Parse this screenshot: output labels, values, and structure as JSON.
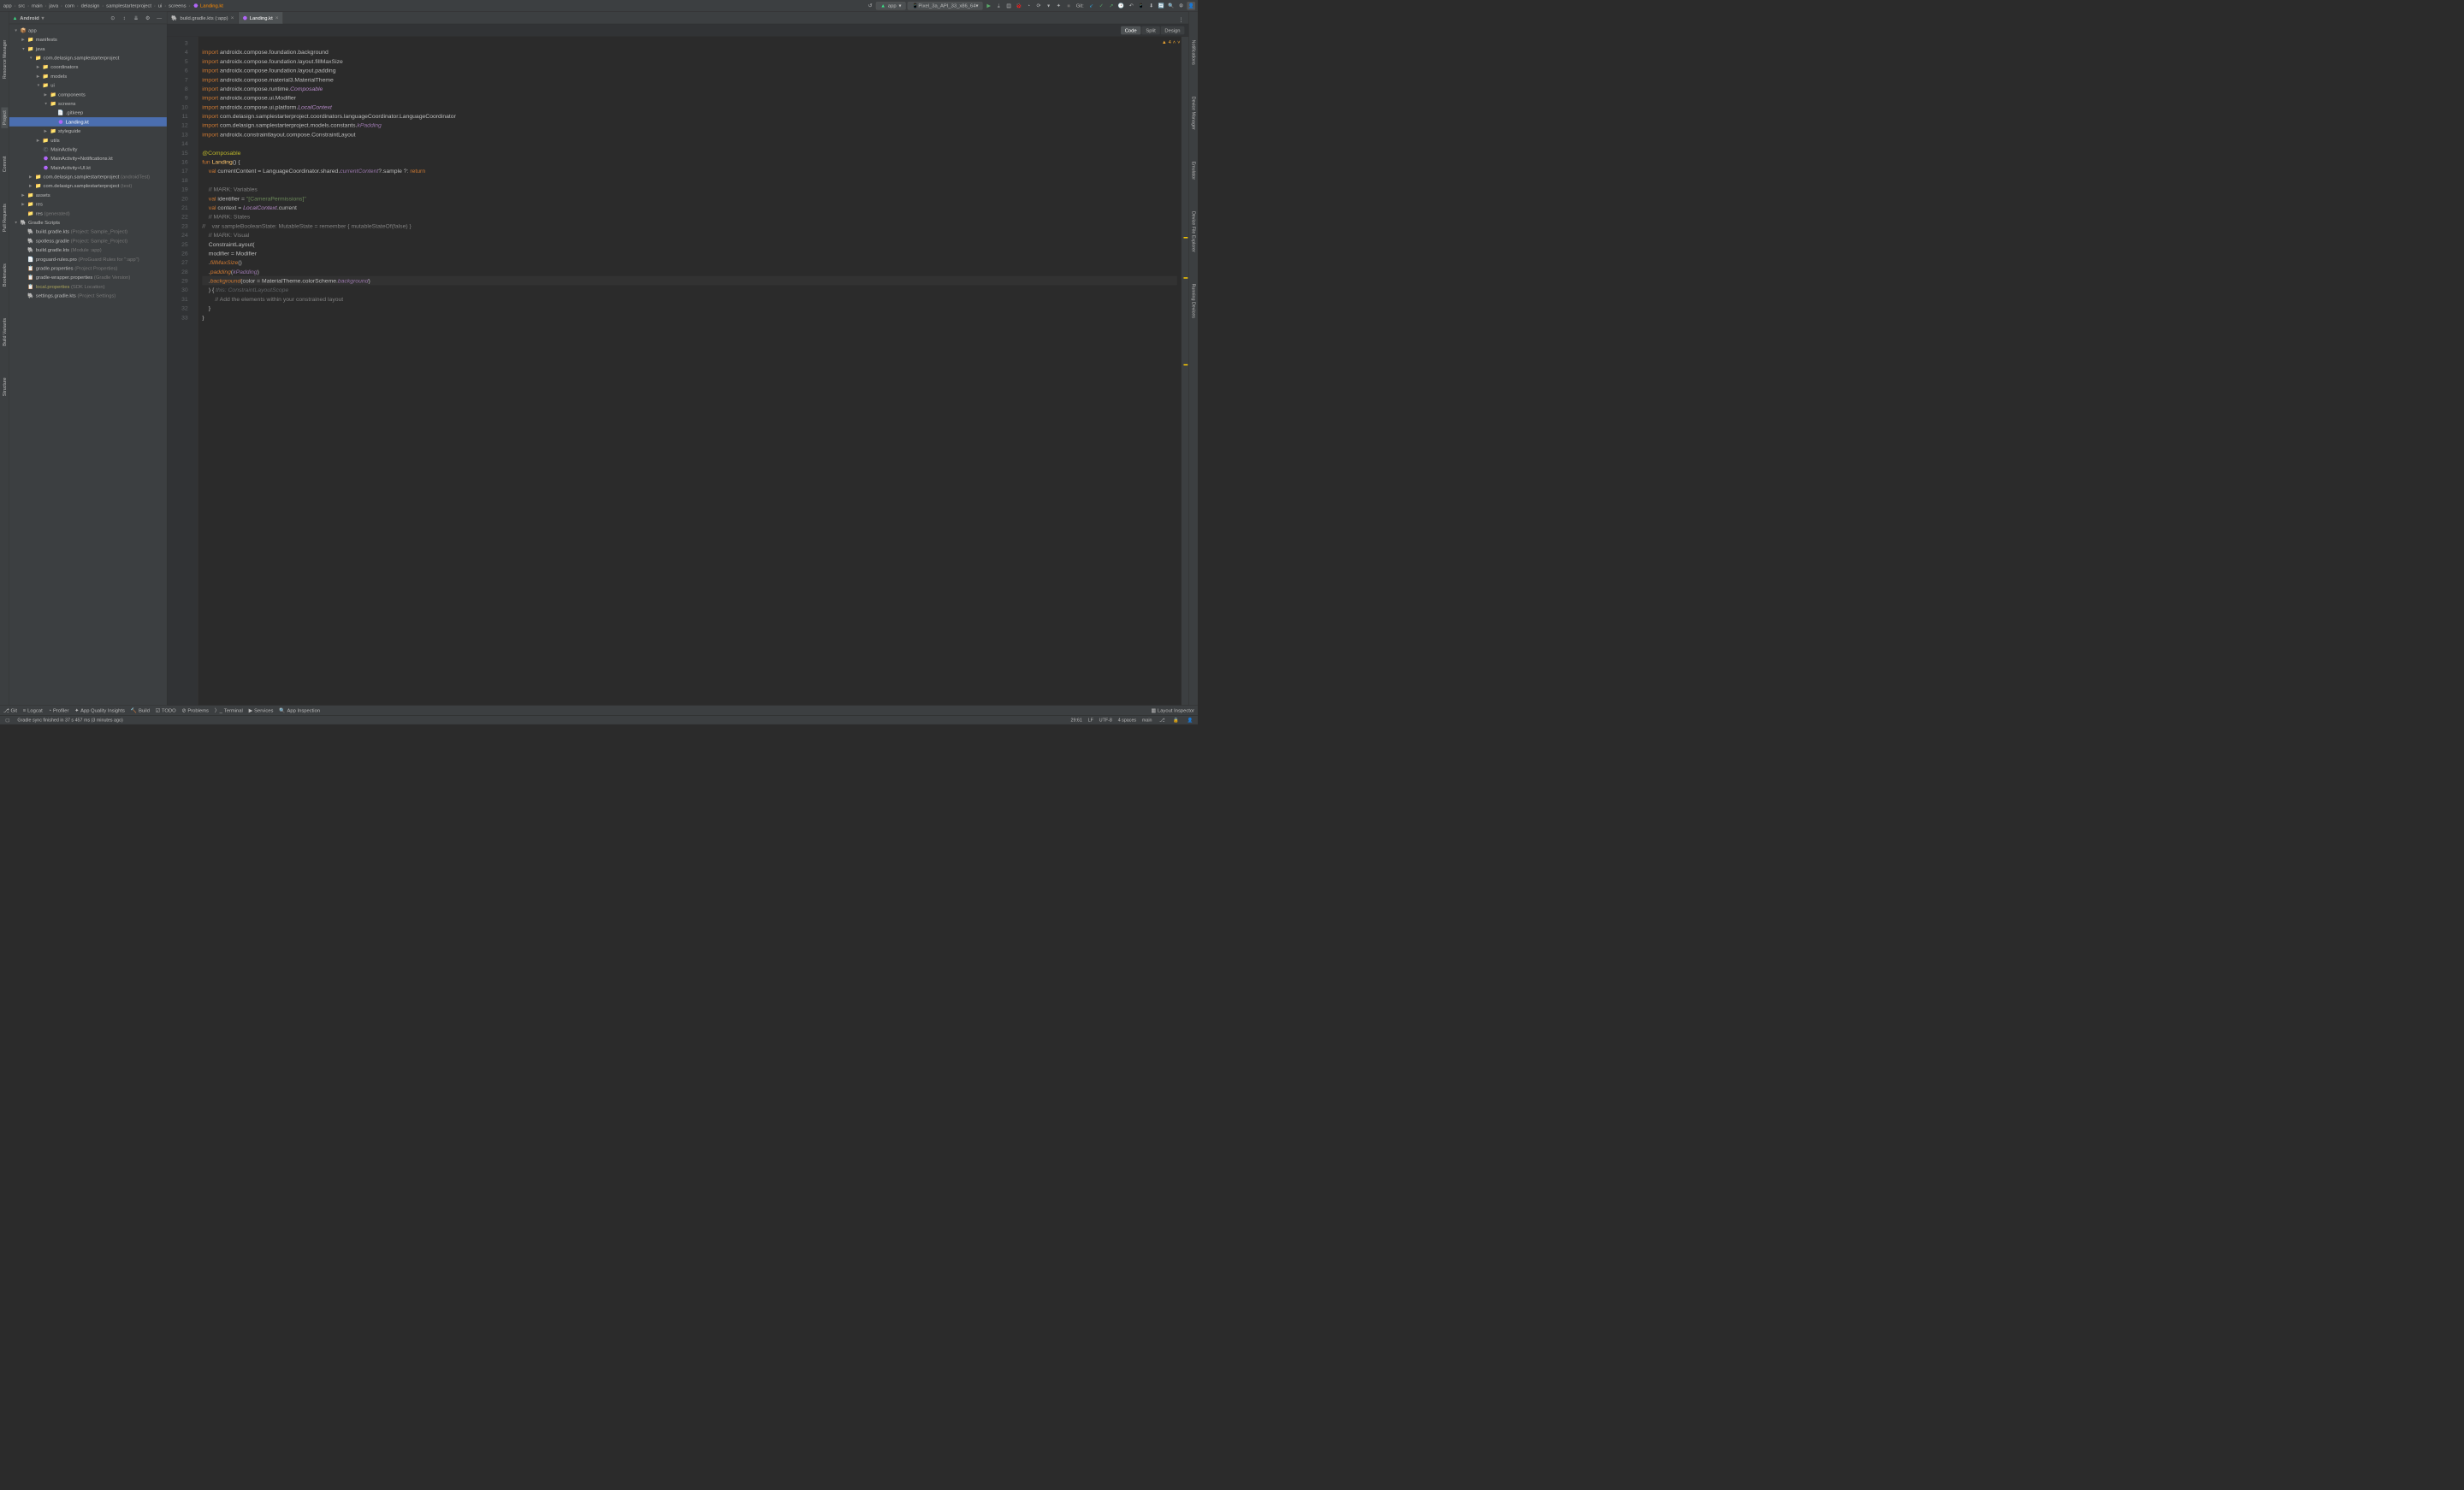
{
  "breadcrumb": [
    "app",
    "src",
    "main",
    "java",
    "com",
    "delasign",
    "samplestarterproject",
    "ui",
    "screens",
    "Landing.kt"
  ],
  "run_config": "app",
  "device": "Pixel_3a_API_33_x86_64",
  "git_label": "Git:",
  "left_rail": [
    {
      "label": "Resource Manager"
    },
    {
      "label": "Project",
      "active": true
    },
    {
      "label": "Commit"
    },
    {
      "label": "Pull Requests"
    },
    {
      "label": "Bookmarks"
    },
    {
      "label": "Build Variants"
    },
    {
      "label": "Structure"
    }
  ],
  "right_rail": [
    {
      "label": "Notifications"
    },
    {
      "label": "Device Manager"
    },
    {
      "label": "Emulator"
    },
    {
      "label": "Device File Explorer"
    },
    {
      "label": "Running Devices"
    }
  ],
  "panel_title": "Android",
  "tree": [
    {
      "d": 0,
      "a": "v",
      "i": "mod",
      "t": "app"
    },
    {
      "d": 1,
      "a": ">",
      "i": "dir",
      "t": "manifests"
    },
    {
      "d": 1,
      "a": "v",
      "i": "dir",
      "t": "java"
    },
    {
      "d": 2,
      "a": "v",
      "i": "pkg",
      "t": "com.delasign.samplestarterproject"
    },
    {
      "d": 3,
      "a": ">",
      "i": "pkg",
      "t": "coordinators"
    },
    {
      "d": 3,
      "a": ">",
      "i": "pkg",
      "t": "models"
    },
    {
      "d": 3,
      "a": "v",
      "i": "pkg",
      "t": "ui"
    },
    {
      "d": 4,
      "a": ">",
      "i": "pkg",
      "t": "components"
    },
    {
      "d": 4,
      "a": "v",
      "i": "pkg",
      "t": "screens"
    },
    {
      "d": 5,
      "a": "",
      "i": "txt",
      "t": ".gitkeep"
    },
    {
      "d": 5,
      "a": "",
      "i": "kt",
      "t": "Landing.kt",
      "sel": true
    },
    {
      "d": 4,
      "a": ">",
      "i": "pkg",
      "t": "styleguide"
    },
    {
      "d": 3,
      "a": ">",
      "i": "pkg",
      "t": "utils"
    },
    {
      "d": 3,
      "a": "",
      "i": "cls",
      "t": "MainActivity"
    },
    {
      "d": 3,
      "a": "",
      "i": "kt",
      "t": "MainActivity+Notifications.kt"
    },
    {
      "d": 3,
      "a": "",
      "i": "kt",
      "t": "MainActivity+UI.kt"
    },
    {
      "d": 2,
      "a": ">",
      "i": "pkg",
      "t": "com.delasign.samplestarterproject",
      "dim": "(androidTest)"
    },
    {
      "d": 2,
      "a": ">",
      "i": "pkg",
      "t": "com.delasign.samplestarterproject",
      "dim": "(test)"
    },
    {
      "d": 1,
      "a": ">",
      "i": "dir",
      "t": "assets"
    },
    {
      "d": 1,
      "a": ">",
      "i": "dir",
      "t": "res"
    },
    {
      "d": 1,
      "a": "",
      "i": "dir",
      "t": "res",
      "dim": "(generated)"
    },
    {
      "d": 0,
      "a": "v",
      "i": "grd",
      "t": "Gradle Scripts"
    },
    {
      "d": 1,
      "a": "",
      "i": "grf",
      "t": "build.gradle.kts",
      "dim": "(Project: Sample_Project)"
    },
    {
      "d": 1,
      "a": "",
      "i": "grf",
      "t": "spotless.gradle",
      "dim": "(Project: Sample_Project)"
    },
    {
      "d": 1,
      "a": "",
      "i": "grf",
      "t": "build.gradle.kts",
      "dim": "(Module :app)"
    },
    {
      "d": 1,
      "a": "",
      "i": "txt",
      "t": "proguard-rules.pro",
      "dim": "(ProGuard Rules for \":app\")"
    },
    {
      "d": 1,
      "a": "",
      "i": "prp",
      "t": "gradle.properties",
      "dim": "(Project Properties)"
    },
    {
      "d": 1,
      "a": "",
      "i": "prp",
      "t": "gradle-wrapper.properties",
      "dim": "(Gradle Version)"
    },
    {
      "d": 1,
      "a": "",
      "i": "prp",
      "t": "local.properties",
      "dim": "(SDK Location)",
      "y": true
    },
    {
      "d": 1,
      "a": "",
      "i": "grf",
      "t": "settings.gradle.kts",
      "dim": "(Project Settings)"
    }
  ],
  "editor_tabs": [
    {
      "label": "build.gradle.kts (:app)",
      "icon": "grf"
    },
    {
      "label": "Landing.kt",
      "icon": "kt",
      "active": true
    }
  ],
  "view_modes": [
    {
      "label": "Code",
      "active": true
    },
    {
      "label": "Split"
    },
    {
      "label": "Design"
    }
  ],
  "warnings": "4",
  "code_start_line": 3,
  "code_lines": [
    "",
    "<kw>import</kw> androidx.compose.foundation.background",
    "<kw>import</kw> androidx.compose.foundation.layout.fillMaxSize",
    "<kw>import</kw> androidx.compose.foundation.layout.padding",
    "<kw>import</kw> androidx.compose.material3.MaterialTheme",
    "<kw>import</kw> androidx.compose.runtime.<ital>Composable</ital>",
    "<kw>import</kw> androidx.compose.ui.Modifier",
    "<kw>import</kw> androidx.compose.ui.platform.<ital>LocalContext</ital>",
    "<kw>import</kw> com.delasign.samplestarterproject.coordinators.languageCoordinator.LanguageCoordinator",
    "<kw>import</kw> com.delasign.samplestarterproject.models.constants.<ital2>kPadding</ital2>",
    "<kw>import</kw> androidx.constraintlayout.compose.ConstraintLayout",
    "",
    "<anno>@Composable</anno>",
    "<kw>fun</kw> <fname>Landing</fname>() {",
    "    <kw>val</kw> currentContent = LanguageCoordinator.shared.<ital2>currentContent</ital2>?.sample ?: <kw>return</kw>",
    "",
    "    <com>// MARK: Variables</com>",
    "    <kw>val</kw> identifier = <str>\"[CameraPermissions]\"</str>",
    "    <kw>val</kw> context = <ital>LocalContext</ital>.current",
    "    <com>// MARK: States</com>",
    "<com>//    var sampleBooleanState: MutableState<Boolean> = remember { mutableStateOf(false) }</com>",
    "    <com>// MARK: Visual</com>",
    "    ConstraintLayout(",
    "    modifier = Modifier",
    "    .<fn-it>fillMaxSize</fn-it>()",
    "    .<fn-it>padding</fn-it>(<ital2>kPadding</ital2>)",
    "    .<fn-it>background</fn-it>(color = MaterialTheme.colorScheme.<ital2>background</ital2>)",
    "    ) { <hint>this: ConstraintLayoutScope</hint>",
    "        <com>// Add the elements within your constrained layout</com>",
    "    }",
    "}"
  ],
  "highlighted_line_index": 26,
  "bottom_tools": [
    "Git",
    "Logcat",
    "Profiler",
    "App Quality Insights",
    "Build",
    "TODO",
    "Problems",
    "Terminal",
    "Services",
    "App Inspection"
  ],
  "bottom_right": "Layout Inspector",
  "status_msg": "Gradle sync finished in 37 s 457 ms (3 minutes ago)",
  "status_right": [
    "29:61",
    "LF",
    "UTF-8",
    "4 spaces",
    "main"
  ]
}
